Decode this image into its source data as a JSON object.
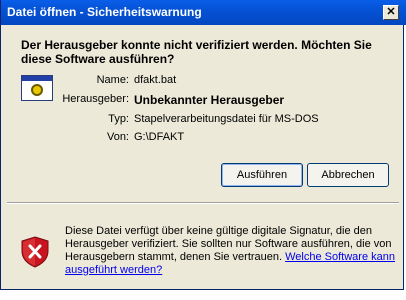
{
  "window": {
    "title": "Datei öffnen - Sicherheitswarnung",
    "close_glyph": "✕"
  },
  "headline": "Der Herausgeber konnte nicht verifiziert werden. Möchten Sie diese Software ausführen?",
  "app_icon": "batch-file-icon",
  "info": [
    {
      "label": "Name:",
      "value": "dfakt.bat",
      "bold": false
    },
    {
      "label": "Herausgeber:",
      "value": "Unbekannter Herausgeber",
      "bold": true
    },
    {
      "label": "Typ:",
      "value": "Stapelverarbeitungsdatei für MS-DOS",
      "bold": false
    },
    {
      "label": "Von:",
      "value": "G:\\DFAKT",
      "bold": false
    }
  ],
  "buttons": {
    "run": "Ausführen",
    "cancel": "Abbrechen"
  },
  "warning": {
    "icon": "security-shield-icon",
    "text": "Diese Datei verfügt über keine gültige digitale Signatur, die den Herausgeber verifiziert. Sie sollten nur Software ausführen, die von Herausgebern stammt, denen Sie vertrauen.",
    "link": "Welche Software kann ausgeführt werden?"
  },
  "colors": {
    "title_bar": "#0552d6",
    "dialog_bg": "#ece9d8",
    "link": "#0000ee",
    "shield": "#c8141e"
  }
}
